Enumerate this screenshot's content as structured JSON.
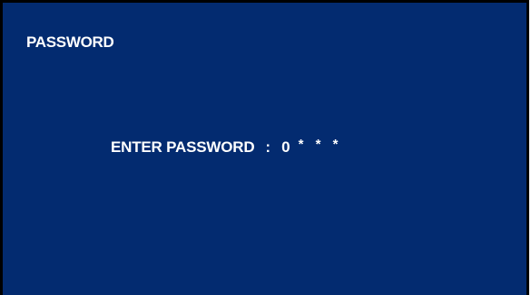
{
  "screen": {
    "title": "PASSWORD",
    "prompt_label": "ENTER PASSWORD",
    "separator": ":",
    "password_chars": [
      "0",
      "*",
      "*",
      "*"
    ]
  },
  "colors": {
    "background": "#032b70",
    "text": "#ffffff",
    "border": "#000000"
  }
}
